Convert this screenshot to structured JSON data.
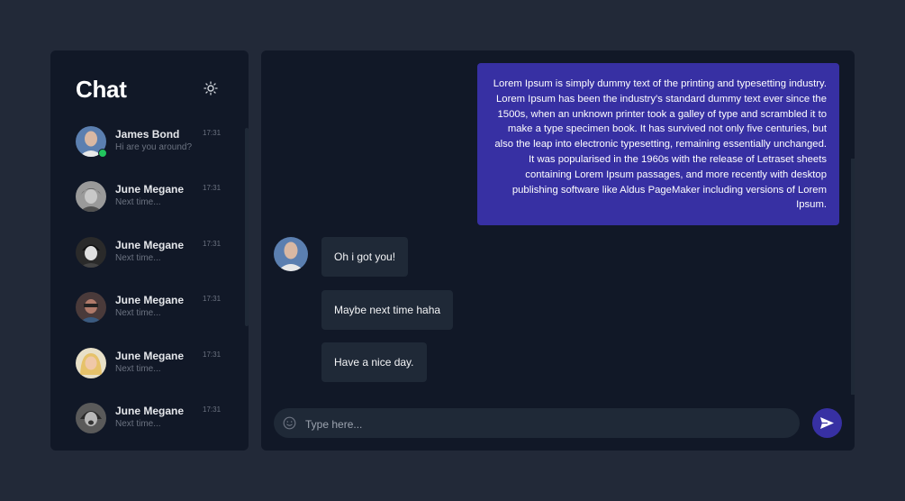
{
  "sidebar": {
    "title": "Chat",
    "theme_icon": "sun-icon",
    "contacts": [
      {
        "name": "James Bond",
        "message": "Hi are you around?",
        "time": "17:31",
        "online": true
      },
      {
        "name": "June Megane",
        "message": "Next time...",
        "time": "17:31",
        "online": false
      },
      {
        "name": "June Megane",
        "message": "Next time...",
        "time": "17:31",
        "online": false
      },
      {
        "name": "June Megane",
        "message": "Next time...",
        "time": "17:31",
        "online": false
      },
      {
        "name": "June Megane",
        "message": "Next time...",
        "time": "17:31",
        "online": false
      },
      {
        "name": "June Megane",
        "message": "Next time...",
        "time": "17:31",
        "online": false
      }
    ]
  },
  "conversation": {
    "outgoing": "Lorem Ipsum is simply dummy text of the printing and typesetting industry. Lorem Ipsum has been the industry's standard dummy text ever since the 1500s, when an unknown printer took a galley of type and scrambled it to make a type specimen book. It has survived not only five centuries, but also the leap into electronic typesetting, remaining essentially unchanged. It was popularised in the 1960s with the release of Letraset sheets containing Lorem Ipsum passages, and more recently with desktop publishing software like Aldus PageMaker including versions of Lorem Ipsum.",
    "incoming": [
      "Oh i got you!",
      "Maybe next time haha",
      "Have a nice day."
    ]
  },
  "composer": {
    "placeholder": "Type here...",
    "value": "",
    "emoji_icon": "smiley-icon",
    "send_icon": "send-icon"
  },
  "colors": {
    "background": "#222938",
    "panel": "#111827",
    "bubble_out": "#3730a3",
    "bubble_in": "#1f2937",
    "online": "#22c55e"
  }
}
